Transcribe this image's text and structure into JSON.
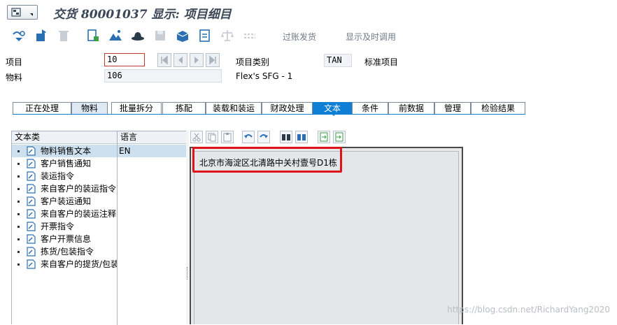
{
  "window": {
    "title": "交货 80001037 显示: 项目细目"
  },
  "toolbar": {
    "icons": [
      "config-icon",
      "export-icon",
      "trash-icon",
      "document-icon",
      "mountain-icon",
      "hat-icon",
      "save-icon",
      "package-icon",
      "document2-icon",
      "scale-icon",
      "link-icon"
    ],
    "post_goods_issue_label": "过账发货",
    "display_time_label": "显示及时调用"
  },
  "header": {
    "item_label": "项目",
    "item_value": "10",
    "material_label": "物料",
    "material_value": "106",
    "material_desc": "Flex's SFG - 1",
    "item_category_label": "项目类别",
    "item_category_value": "TAN",
    "item_category_desc": "标准项目"
  },
  "tabs": [
    {
      "label": "正在处理"
    },
    {
      "label": "物料"
    },
    {
      "label": "批量拆分"
    },
    {
      "label": "拣配"
    },
    {
      "label": "装载和装运"
    },
    {
      "label": "财政处理"
    },
    {
      "label": "文本"
    },
    {
      "label": "条件"
    },
    {
      "label": "前数据"
    },
    {
      "label": "管理"
    },
    {
      "label": "检验结果"
    }
  ],
  "active_tab": "文本",
  "text_types": {
    "col_text_type": "文本类",
    "col_language": "语言",
    "items": [
      {
        "label": "物料销售文本",
        "lang": "EN"
      },
      {
        "label": "客户销售通知",
        "lang": ""
      },
      {
        "label": "装运指令",
        "lang": ""
      },
      {
        "label": "来自客户的装运指令",
        "lang": ""
      },
      {
        "label": "客户装运通知",
        "lang": ""
      },
      {
        "label": "来自客户的装运注释",
        "lang": ""
      },
      {
        "label": "开票指令",
        "lang": ""
      },
      {
        "label": "客户开票信息",
        "lang": ""
      },
      {
        "label": "拣货/包装指令",
        "lang": ""
      },
      {
        "label": "来自客户的提货/包装",
        "lang": ""
      }
    ]
  },
  "editor": {
    "content": "北京市海淀区北清路中关村壹号D1栋"
  },
  "watermark": "https://blog.csdn.net/RichardYang2020",
  "colors": {
    "active_tab": "#0f7fd6",
    "highlight_box": "#e0131a",
    "title_text": "#3b4756"
  }
}
